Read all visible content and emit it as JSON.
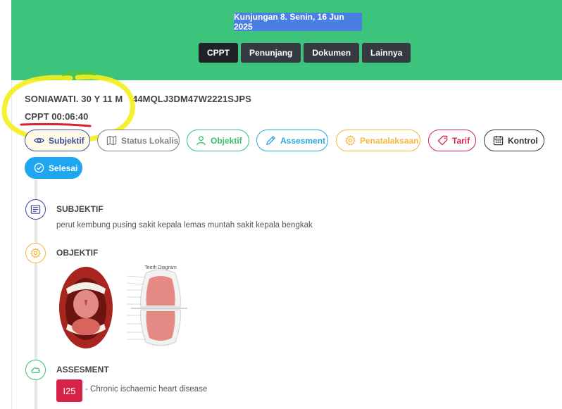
{
  "header": {
    "visit_label": "Kunjungan 8. Senin, 16 Jun 2025",
    "tabs": [
      {
        "label": "CPPT",
        "active": true
      },
      {
        "label": "Penunjang",
        "active": false
      },
      {
        "label": "Dokumen",
        "active": false
      },
      {
        "label": "Lainnya",
        "active": false
      }
    ],
    "color": "#3cc47c"
  },
  "patient": {
    "name_age": "SONIAWATI. 30 Y 11 M",
    "record_id": "44MQLJ3DM47W2221SJPS",
    "timer": "CPPT 00:06:40"
  },
  "actions": [
    {
      "label": "Subjektif",
      "icon": "eye-icon",
      "color": "#3c4a9c"
    },
    {
      "label": "Status Lokalis",
      "icon": "map-icon",
      "color": "#7b7f86"
    },
    {
      "label": "Objektif",
      "icon": "user-icon",
      "color": "#3cbf73"
    },
    {
      "label": "Assesment",
      "icon": "pencil-icon",
      "color": "#2aa7e0"
    },
    {
      "label": "Penatalaksaan",
      "icon": "gear-icon",
      "color": "#f5b83a"
    },
    {
      "label": "Tarif",
      "icon": "tag-icon",
      "color": "#d7234a"
    },
    {
      "label": "Kontrol",
      "icon": "calendar-icon",
      "color": "#333333"
    },
    {
      "label": "Selesai",
      "icon": "check-circle-icon",
      "color": "#1ea7f0"
    }
  ],
  "timeline": {
    "subjektif": {
      "title": "SUBJEKTIF",
      "text": "perut kembung pusing sakit kepala lemas muntah sakit kepala bengkak",
      "icon": "list-icon",
      "color": "#3c4a9c"
    },
    "objektif": {
      "title": "OBJEKTIF",
      "image_title": "Teeth Diagram",
      "icon": "gear-icon",
      "color": "#f5b83a"
    },
    "assesment": {
      "title": "ASSESMENT",
      "icd_code": "I25",
      "icd_desc": "- Chronic ischaemic heart disease",
      "icon": "cloud-icon",
      "color": "#3cbf73"
    }
  }
}
